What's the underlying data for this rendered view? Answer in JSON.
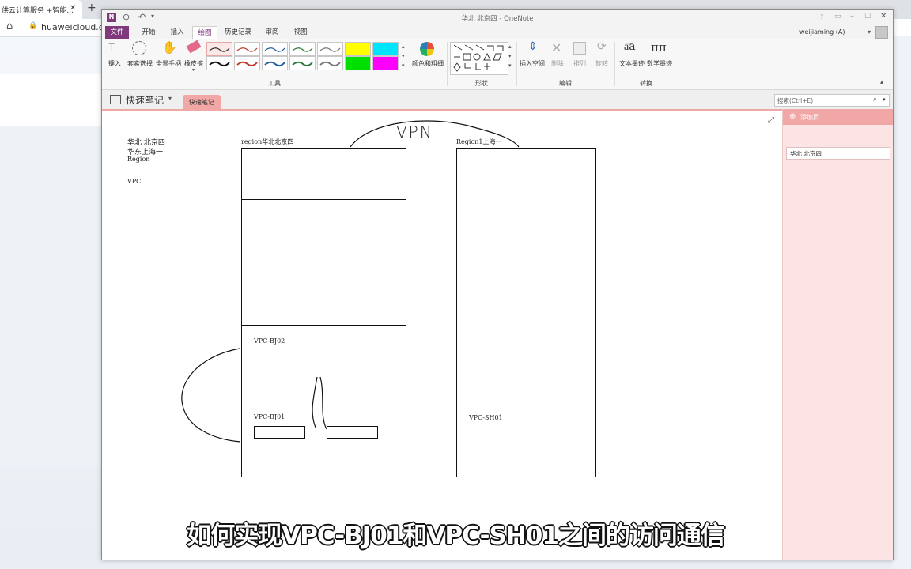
{
  "browser": {
    "tab_title": "供云计算服务 +智能...",
    "address": "huaweicloud.com",
    "new_tab_label": "+"
  },
  "window": {
    "title": "华北 北京四 - OneNote",
    "user": "weijiaming (A)",
    "help": "?"
  },
  "tabs": [
    "文件",
    "开始",
    "插入",
    "绘图",
    "历史记录",
    "审阅",
    "视图"
  ],
  "active_tab": "绘图",
  "ribbon": {
    "tool_type": "键入",
    "lasso": "套索选择",
    "pan": "全景手柄",
    "eraser": "橡皮擦",
    "color_thickness": "颜色和粗细",
    "group_tools": "工具",
    "group_shapes": "形状",
    "insert_space": "插入空间",
    "delete": "删除",
    "arrange": "排列",
    "rotate": "旋转",
    "group_edit": "编辑",
    "ink_to_text": "文本墨迹",
    "ink_to_math": "数学墨迹",
    "group_convert": "转换"
  },
  "notebook": {
    "name": "快速笔记",
    "section_tab": "快速笔记",
    "search_placeholder": "搜索(Ctrl+E)",
    "add_page": "添加页",
    "page_item": "华北 北京四"
  },
  "canvas": {
    "notes": [
      "华北 北京四",
      "华东上海一",
      "Region",
      "VPC"
    ],
    "region_left_label": "region华北北京四",
    "region_right_label": "Region1上海一",
    "vpn_text": "VPN",
    "vpc_bj02": "VPC-BJ02",
    "vpc_bj01": "VPC-BJ01",
    "vpc_sh01": "VPC-SH01"
  },
  "subtitle": "如何实现VPC-BJ01和VPC-SH01之间的访问通信",
  "colors": {
    "accent_purple": "#80397b",
    "section_pink": "#f2a7a7",
    "page_pane": "#fce4e4",
    "highlight_yellow": "#ffff00",
    "highlight_cyan": "#00e5ff",
    "highlight_green": "#00e000",
    "highlight_magenta": "#ff00ff"
  }
}
